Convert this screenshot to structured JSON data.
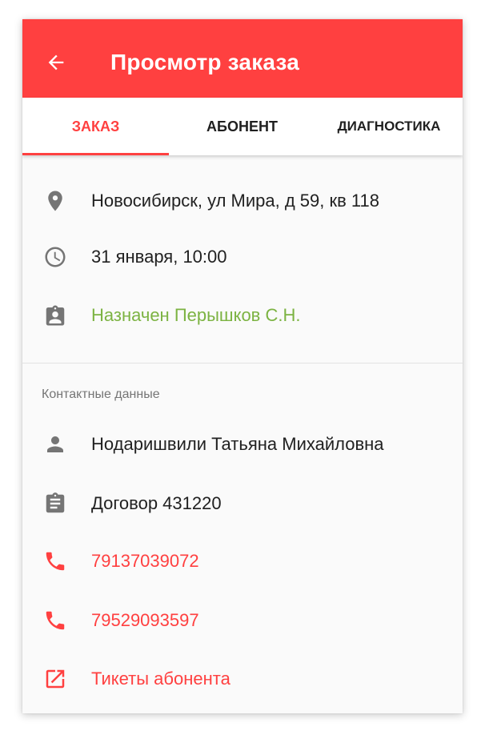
{
  "appbar": {
    "title": "Просмотр заказа",
    "color": "#ff4040"
  },
  "tabs": [
    {
      "label": "ЗАКАЗ",
      "active": true
    },
    {
      "label": "АБОНЕНТ",
      "active": false
    },
    {
      "label": "ДИАГНОСТИКА",
      "active": false
    }
  ],
  "order": {
    "address": "Новосибирск, ул Мира, д 59, кв 118",
    "datetime": "31 января, 10:00",
    "assigned": "Назначен Перышков С.Н."
  },
  "contacts": {
    "section_label": "Контактные данные",
    "name": "Нодаришвили Татьяна Михайловна",
    "contract": "Договор 431220",
    "phones": [
      "79137039072",
      "79529093597"
    ],
    "tickets_link": "Тикеты абонента"
  },
  "icons": {
    "back": "arrow-left-icon",
    "location": "location-pin-icon",
    "time": "clock-icon",
    "assigned": "badge-icon",
    "person": "person-icon",
    "contract": "clipboard-icon",
    "phone": "phone-icon",
    "external": "open-in-new-icon"
  },
  "colors": {
    "accent": "#ff4040",
    "assigned_text": "#7cb342",
    "icon_gray": "#757575"
  }
}
